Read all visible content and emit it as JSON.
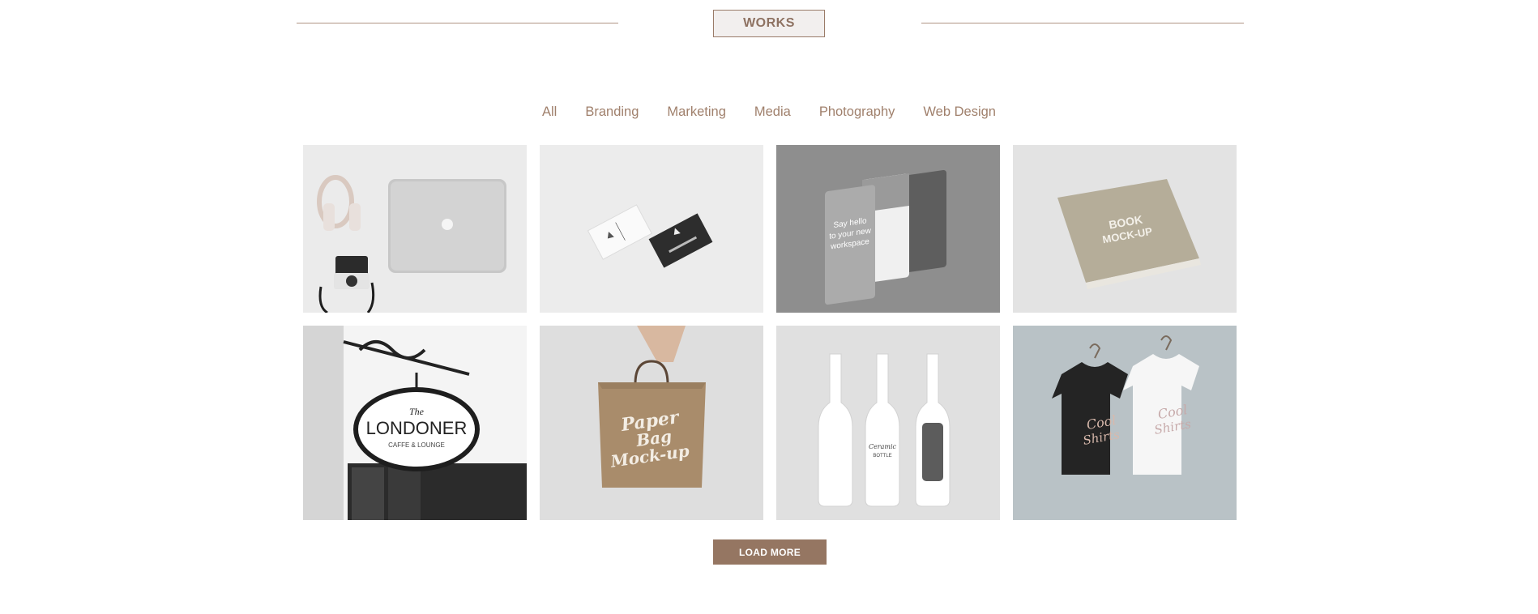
{
  "section": {
    "title": "WORKS"
  },
  "filters": [
    "All",
    "Branding",
    "Marketing",
    "Media",
    "Photography",
    "Web Design"
  ],
  "portfolio": {
    "items": [
      {
        "name": "laptop-headphones-camera"
      },
      {
        "name": "business-cards"
      },
      {
        "name": "mobile-app-screens",
        "text": [
          "Say hello",
          "to your new",
          "workspace"
        ]
      },
      {
        "name": "book-mockup",
        "text": [
          "BOOK",
          "MOCK-UP"
        ]
      },
      {
        "name": "cafe-sign",
        "text": [
          "The",
          "LONDONER",
          "CAFFE & LOUNGE"
        ]
      },
      {
        "name": "paper-bag",
        "text": [
          "Paper",
          "Bag",
          "Mock-up"
        ]
      },
      {
        "name": "ceramic-bottles",
        "text": [
          "Ceramic",
          "BOTTLE"
        ]
      },
      {
        "name": "t-shirts",
        "text": [
          "Cool",
          "Shirts"
        ]
      }
    ]
  },
  "load_more": {
    "label": "LOAD MORE"
  },
  "colors": {
    "accent": "#957662",
    "filter_text": "#a0806c",
    "rule": "#b09585"
  }
}
